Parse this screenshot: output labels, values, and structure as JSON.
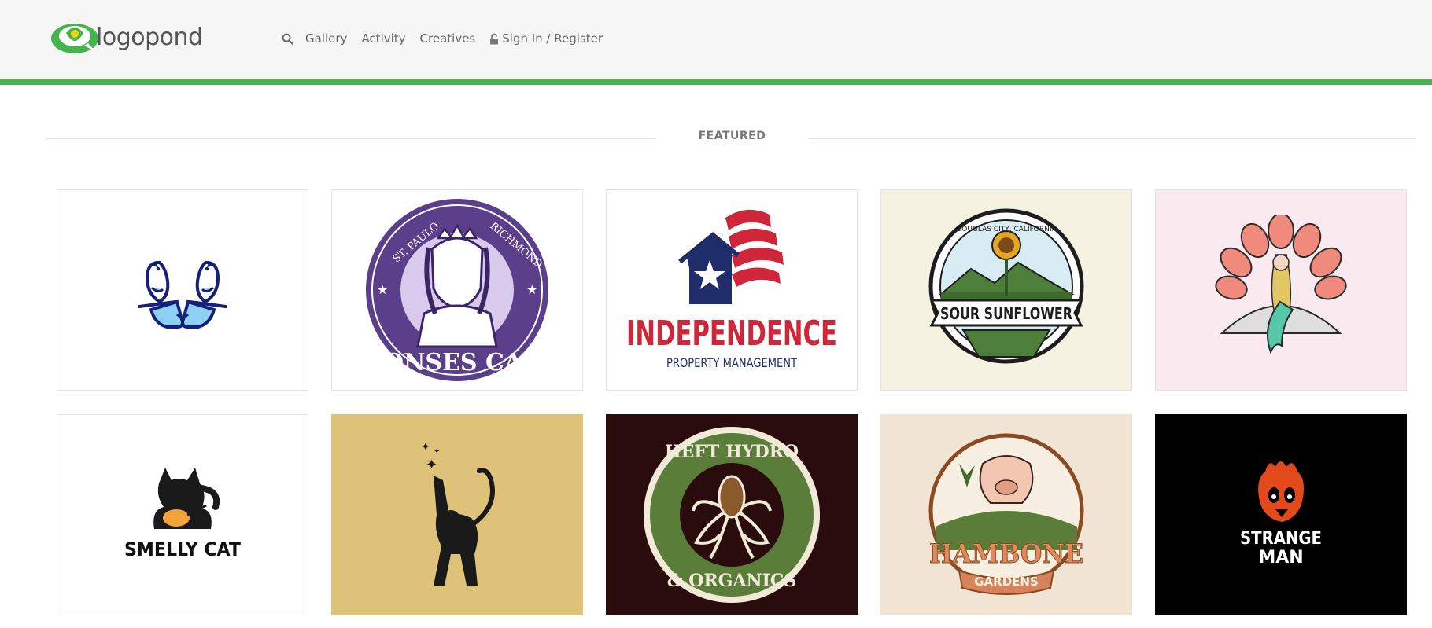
{
  "site": {
    "logo_text": "logopond",
    "accent_color": "#4caf50"
  },
  "nav": {
    "search_icon": "search-icon",
    "items": [
      {
        "label": "Gallery"
      },
      {
        "label": "Activity"
      },
      {
        "label": "Creatives"
      }
    ],
    "auth_icon": "lock-icon",
    "auth_label": "Sign In / Register"
  },
  "featured": {
    "label": "FEATURED",
    "cards": [
      {
        "name": "bird-cat",
        "bg": "#ffffff"
      },
      {
        "name": "monses-cafe",
        "bg": "#ffffff",
        "arc_left": "ST. PAULO",
        "arc_right": "RICHMOND",
        "title": "MONSES CAFE"
      },
      {
        "name": "independence",
        "bg": "#ffffff",
        "title": "INDEPENDENCE",
        "subtitle": "PROPERTY MANAGEMENT"
      },
      {
        "name": "sour-sunflower",
        "bg": "#f6f2e2",
        "arc_top": "DOUGLAS CITY, CALIFORNIA",
        "title": "SOUR SUNFLOWER"
      },
      {
        "name": "mermaid",
        "bg": "#f9eaf0"
      },
      {
        "name": "smelly-cat",
        "bg": "#ffffff",
        "title": "SMELLY CAT"
      },
      {
        "name": "monkey-stars",
        "bg": "#dfc27a"
      },
      {
        "name": "heft-hydro",
        "bg": "#2a0c0c",
        "title_top": "HEFT HYDRO",
        "title_bottom": "& ORGANICS"
      },
      {
        "name": "hambone-gardens",
        "bg": "#f1e4d4",
        "title": "HAMBONE",
        "subtitle": "GARDENS"
      },
      {
        "name": "strange-man",
        "bg": "#000000",
        "title": "STRANGE",
        "subtitle": "MAN"
      }
    ]
  }
}
